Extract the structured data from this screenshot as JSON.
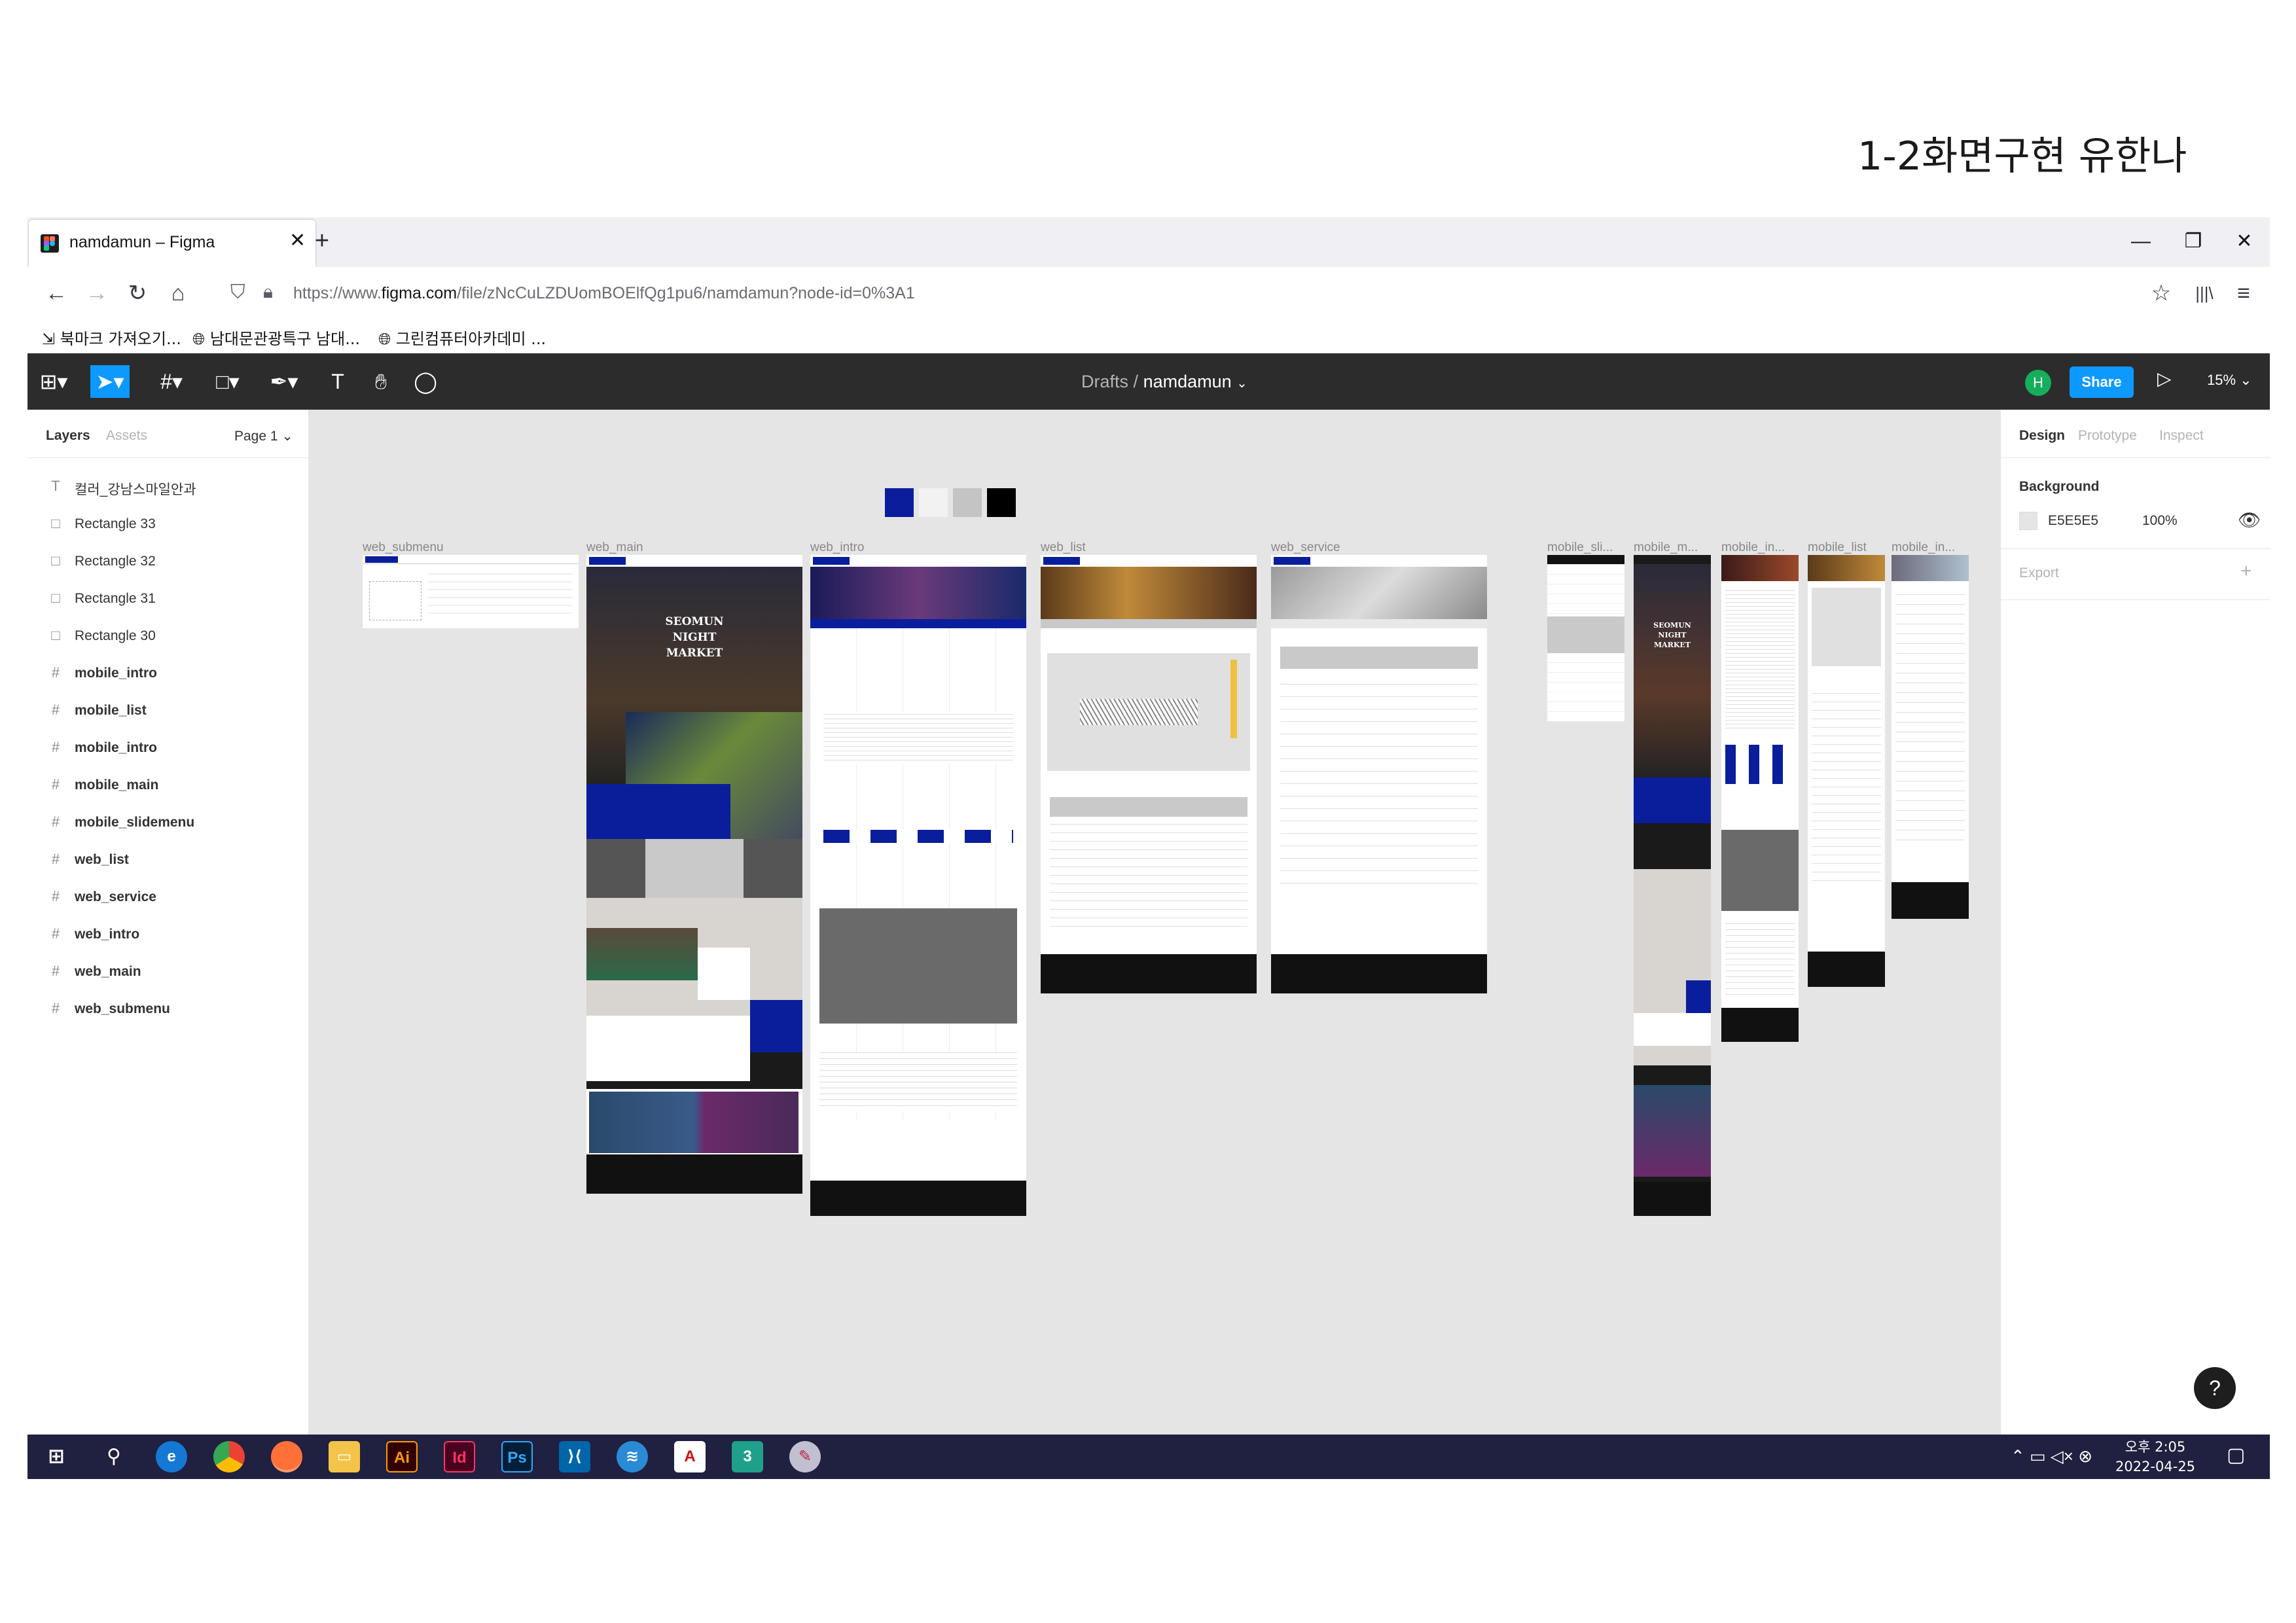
{
  "slide_title": "1-2화면구현 유한나",
  "browser": {
    "tab_title": "namdamun – Figma",
    "new_tab": "+",
    "close": "✕",
    "url_prefix": "https://www.",
    "url_domain": "figma.com",
    "url_rest": "/file/zNcCuLZDUomBOElfQg1pu6/namdamun?node-id=0%3A1",
    "bookmarks": [
      "북마크 가져오기...",
      "남대문관광특구 남대...",
      "그린컴퓨터아카데미 ..."
    ]
  },
  "figma": {
    "breadcrumb_parent": "Drafts",
    "breadcrumb_sep": "/",
    "file_name": "namdamun",
    "avatar_initial": "H",
    "share_label": "Share",
    "zoom_label": "15%"
  },
  "left_panel": {
    "tab_layers": "Layers",
    "tab_assets": "Assets",
    "page": "Page 1",
    "layers": [
      {
        "type": "text",
        "name": "컬러_강남스마일안과"
      },
      {
        "type": "rect",
        "name": "Rectangle 33"
      },
      {
        "type": "rect",
        "name": "Rectangle 32"
      },
      {
        "type": "rect",
        "name": "Rectangle 31"
      },
      {
        "type": "rect",
        "name": "Rectangle 30"
      },
      {
        "type": "frame",
        "name": "mobile_intro"
      },
      {
        "type": "frame",
        "name": "mobile_list"
      },
      {
        "type": "frame",
        "name": "mobile_intro"
      },
      {
        "type": "frame",
        "name": "mobile_main"
      },
      {
        "type": "frame",
        "name": "mobile_slidemenu"
      },
      {
        "type": "frame",
        "name": "web_list"
      },
      {
        "type": "frame",
        "name": "web_service"
      },
      {
        "type": "frame",
        "name": "web_intro"
      },
      {
        "type": "frame",
        "name": "web_main"
      },
      {
        "type": "frame",
        "name": "web_submenu"
      }
    ]
  },
  "canvas": {
    "swatch_colors": [
      "#0a1e9c",
      "#f2f2f2",
      "#c4c4c4",
      "#000000"
    ],
    "frame_labels": [
      "web_submenu",
      "web_main",
      "web_intro",
      "web_list",
      "web_service",
      "mobile_sli...",
      "mobile_m...",
      "mobile_in...",
      "mobile_list",
      "mobile_in..."
    ],
    "hero_text": "SEOMUN NIGHT MARKET"
  },
  "right_panel": {
    "tab_design": "Design",
    "tab_prototype": "Prototype",
    "tab_inspect": "Inspect",
    "background_label": "Background",
    "bg_hex": "E5E5E5",
    "bg_opacity": "100%",
    "export_label": "Export"
  },
  "taskbar": {
    "time": "오후 2:05",
    "date": "2022-04-25"
  },
  "colors": {
    "figma_blue": "#0d99ff",
    "brand_navy": "#0a1e9c",
    "canvas_bg": "#e5e5e5",
    "toolbar_bg": "#2c2c2c"
  }
}
